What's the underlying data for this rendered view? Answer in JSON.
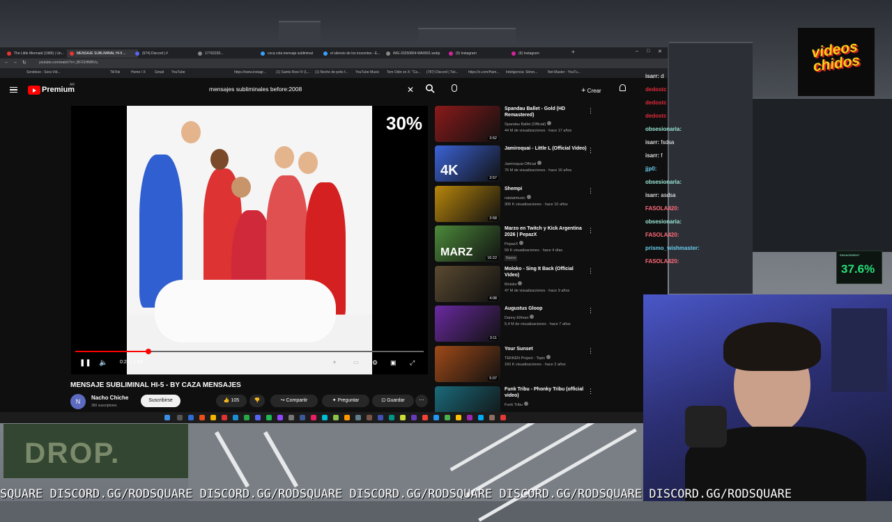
{
  "browser": {
    "tabs": [
      {
        "label": "The Little Mermaid (1989) | Un..."
      },
      {
        "label": "MENSAJE SUBLIMINAL HI-5 ..."
      },
      {
        "label": "(674) Discord | #"
      },
      {
        "label": "17762230..."
      },
      {
        "label": "coca cola mensaje subliminal"
      },
      {
        "label": "el silencio de los inocentes - E..."
      },
      {
        "label": "IMG-20250804-WA0001.webp"
      },
      {
        "label": "(9) Instagram"
      },
      {
        "label": "(9) Instagram"
      }
    ],
    "url": "youtube.com/watch?v=_BF2SHMBVq",
    "bookmarks": [
      "Sonidoso - Sora Vid...",
      "TikTok",
      "Home / X",
      "Gmail",
      "YouTube",
      "https://www.instagr...",
      "(1) Saints Row IV (L...",
      "(1) Noche de pelis f...",
      "YouTube Music",
      "Tom Odin on X: \"Ca...",
      "(787) Discord | Twi...",
      "https://x.com/Ham...",
      "Inteligencia: Stiron...",
      "Net Master - YouTu..."
    ]
  },
  "youtube": {
    "brand": "Premium",
    "country": "AR",
    "search_query": "mensajes subliminales before:2008",
    "create_label": "Crear"
  },
  "player": {
    "overlay_percent": "30%",
    "time": "0:24 / 1:54",
    "progress": 0.21
  },
  "video": {
    "title": "MENSAJE SUBLIMINAL HI-5 - BY CAZA MENSAJES",
    "channel_initial": "N",
    "channel": "Nacho Chiche",
    "subscribers": "350 suscriptores",
    "subscribe_label": "Suscribirse",
    "likes": "105",
    "share_label": "Compartir",
    "ask_label": "Preguntar",
    "save_label": "Guardar"
  },
  "recommendations": [
    {
      "title": "Spandau Ballet - Gold (HD Remastered)",
      "channel": "Spandau Ballet (Official)",
      "meta": "44 M de visualizaciones · hace 17 años",
      "duration": "3:52",
      "color": "#8a1a1a"
    },
    {
      "title": "Jamiroquai - Little L (Official Video)",
      "channel": "Jamiroquai Official",
      "meta": "76 M de visualizaciones · hace 16 años",
      "duration": "3:57",
      "color": "#3b63d6",
      "badge": "4K"
    },
    {
      "title": "Shempi",
      "channel": "ratatatmusic",
      "meta": "306 K visualizaciones · hace 10 años",
      "duration": "3:58",
      "color": "#b8860b"
    },
    {
      "title": "Marzo en Twitch y Kick Argentina 2026 | PepazX",
      "channel": "PepazX",
      "meta": "59 K visualizaciones · hace 4 días",
      "duration": "16:22",
      "color": "#4c8a3a",
      "badge": "MARZ",
      "tag": "Nuevo"
    },
    {
      "title": "Moloko - Sing It Back (Official Video)",
      "channel": "Moloko",
      "meta": "47 M de visualizaciones · hace 9 años",
      "duration": "4:08",
      "color": "#5a4a30"
    },
    {
      "title": "Augustus Gloop",
      "channel": "Danny Elfman",
      "meta": "5,4 M de visualizaciones · hace 7 años",
      "duration": "3:11",
      "color": "#6a2aa0"
    },
    {
      "title": "Your Sunset",
      "channel": "TEKKEN Project - Topic",
      "meta": "160 K visualizaciones · hace 2 años",
      "duration": "5:07",
      "color": "#a04a18"
    },
    {
      "title": "Funk Tribu - Phonky Tribu (official video)",
      "channel": "Funk Tribu",
      "meta": "",
      "duration": "",
      "color": "#1a6a7a"
    }
  ],
  "chat": [
    {
      "user": "isarr:",
      "text": "d",
      "color": "#dfe0e3"
    },
    {
      "user": "dedostc",
      "text": "",
      "color": "#e02a3a"
    },
    {
      "user": "dedostc",
      "text": "",
      "color": "#e02a3a"
    },
    {
      "user": "dedostc",
      "text": "",
      "color": "#e02a3a"
    },
    {
      "user": "obsesionaria:",
      "text": "",
      "color": "#9be8d8"
    },
    {
      "user": "isarr:",
      "text": "fsdsa",
      "color": "#dfe0e3"
    },
    {
      "user": "isarr:",
      "text": "f",
      "color": "#dfe0e3"
    },
    {
      "user": "jjp0:",
      "text": "",
      "color": "#6acff0"
    },
    {
      "user": "obsesionaria:",
      "text": "",
      "color": "#9be8d8"
    },
    {
      "user": "isarr:",
      "text": "asdsa",
      "color": "#dfe0e3"
    },
    {
      "user": "FASOLA420:",
      "text": "",
      "color": "#ff6a7a"
    },
    {
      "user": "obsesionaria:",
      "text": "",
      "color": "#9be8d8"
    },
    {
      "user": "FASOLA420:",
      "text": "",
      "color": "#ff6a7a"
    },
    {
      "user": "prismo_wishmaster:",
      "text": "",
      "color": "#6acff0"
    },
    {
      "user": "FASOLA420:",
      "text": "",
      "color": "#ff6a7a"
    }
  ],
  "overlay": {
    "logo_text": "videos chidos",
    "engagement_label": "ENGAGEMENT",
    "engagement_value": "37.6%",
    "drop_text": "DROP.",
    "ticker": "SQUARE DISCORD.GG/RODSQUARE DISCORD.GG/RODSQUARE DISCORD.GG/RODSQUARE DISCORD.GG/RODSQUARE DISCORD.GG/RODSQUARE"
  }
}
